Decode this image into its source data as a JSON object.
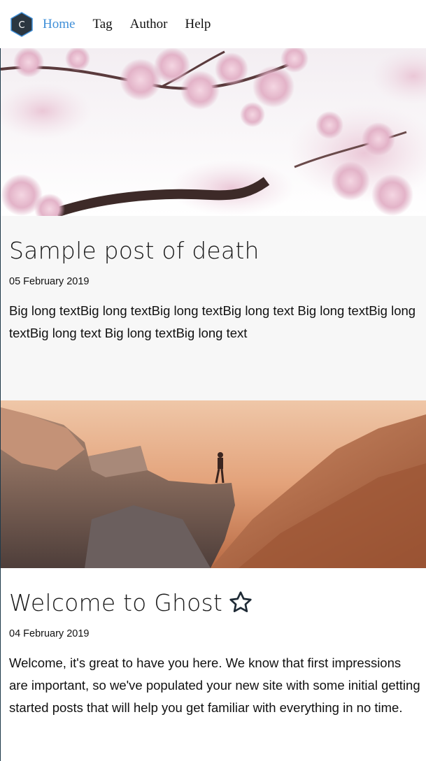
{
  "nav": {
    "logo_letter": "C",
    "items": [
      {
        "label": "Home",
        "active": true
      },
      {
        "label": "Tag",
        "active": false
      },
      {
        "label": "Author",
        "active": false
      },
      {
        "label": "Help",
        "active": false
      }
    ]
  },
  "posts": [
    {
      "title": "Sample post of death",
      "date": "05 February 2019",
      "excerpt": "Big long textBig long textBig long textBig long text Big long textBig long textBig long text Big long textBig long text",
      "image": "cherry-blossom-photo",
      "featured": false
    },
    {
      "title": "Welcome to Ghost",
      "date": "04 February 2019",
      "excerpt": "Welcome, it's great to have you here. We know that first impressions are important, so we've populated your new site with some initial getting started posts that will help you get familiar with everything in no time.",
      "image": "cliff-sunset-photo",
      "featured": true,
      "featured_icon": "star-icon"
    }
  ],
  "colors": {
    "accent": "#3f8fd8",
    "post_bg": "#f7f7f7",
    "logo_bg": "#2b3640",
    "logo_border": "#3f8fd8"
  }
}
